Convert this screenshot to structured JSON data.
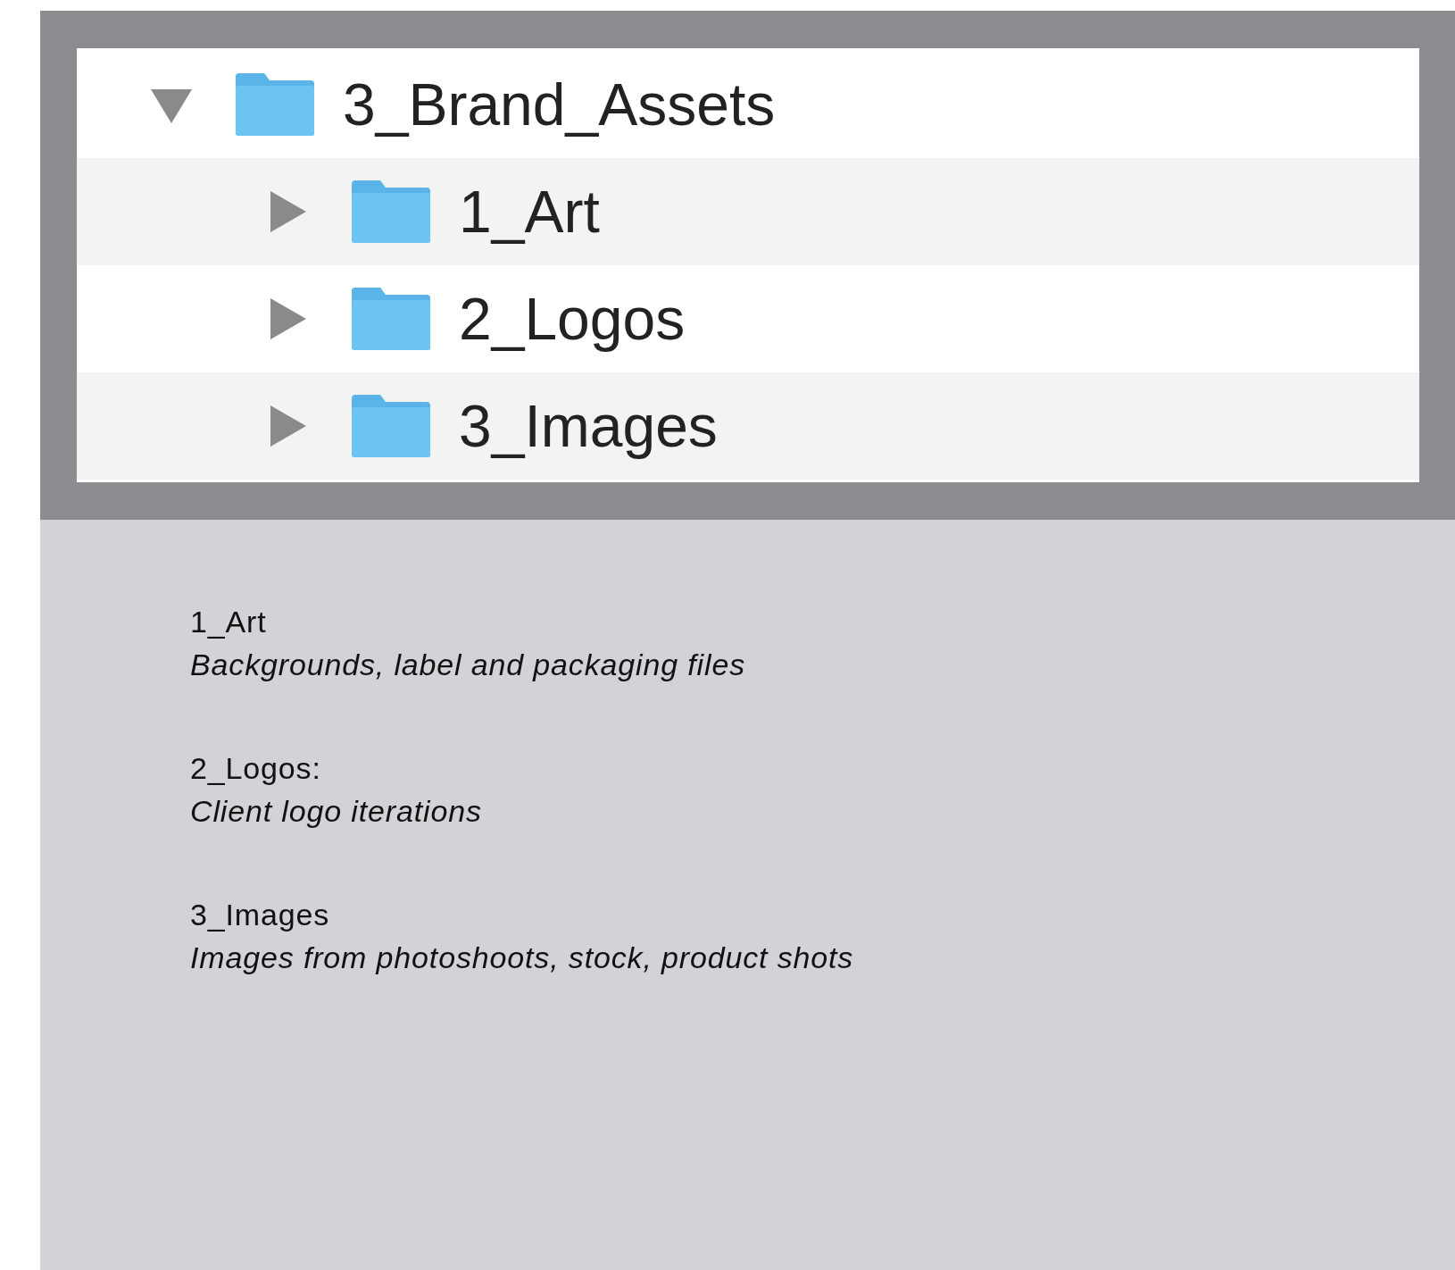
{
  "tree": {
    "label": "3_Brand_Assets",
    "expanded": true,
    "children": [
      {
        "label": "1_Art",
        "expanded": false
      },
      {
        "label": "2_Logos",
        "expanded": false
      },
      {
        "label": "3_Images",
        "expanded": false
      }
    ]
  },
  "notes": [
    {
      "title": "1_Art",
      "description": "Backgrounds, label and packaging files"
    },
    {
      "title": "2_Logos:",
      "description": "Client logo iterations"
    },
    {
      "title": "3_Images",
      "description": "Images from photoshoots, stock, product shots"
    }
  ]
}
